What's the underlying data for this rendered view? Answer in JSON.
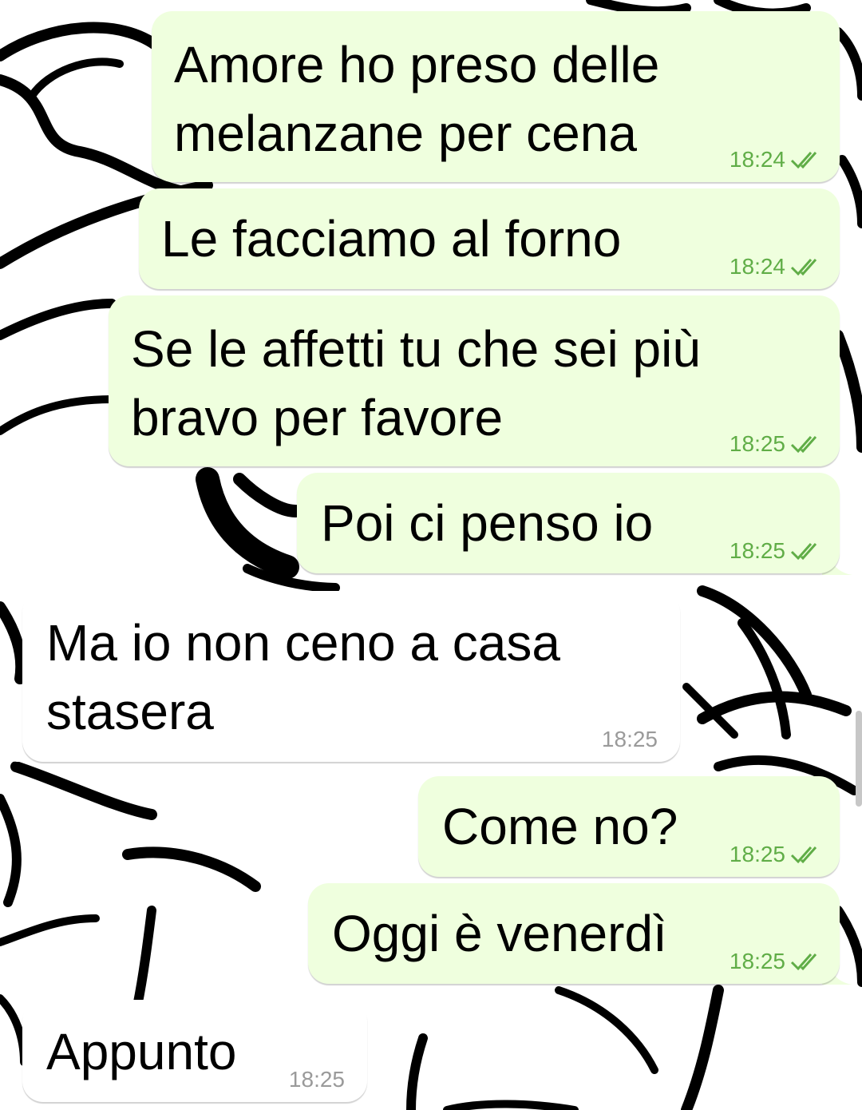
{
  "chat": {
    "messages": [
      {
        "direction": "outgoing",
        "text": "Amore ho preso delle\nmelanzane per cena",
        "time": "18:24",
        "status_icon": "double-check-icon"
      },
      {
        "direction": "outgoing",
        "text": "Le facciamo al forno",
        "time": "18:24",
        "status_icon": "double-check-icon"
      },
      {
        "direction": "outgoing",
        "text": "Se le affetti tu che sei più\nbravo per favore",
        "time": "18:25",
        "status_icon": "double-check-icon"
      },
      {
        "direction": "outgoing",
        "text": "Poi ci penso io",
        "time": "18:25",
        "status_icon": "double-check-icon"
      },
      {
        "direction": "incoming",
        "text": "Ma io non ceno a casa\nstasera",
        "time": "18:25"
      },
      {
        "direction": "outgoing",
        "text": "Come no?",
        "time": "18:25",
        "status_icon": "double-check-icon"
      },
      {
        "direction": "outgoing",
        "text": "Oggi è venerdì",
        "time": "18:25",
        "status_icon": "double-check-icon"
      },
      {
        "direction": "incoming",
        "text": "Appunto",
        "time": "18:25"
      }
    ]
  },
  "colors": {
    "outgoing_bubble": "#efffde",
    "incoming_bubble": "#ffffff",
    "outgoing_time": "#60ad47",
    "incoming_time": "#9a9a9a",
    "wallpaper_lines": "#000000"
  }
}
